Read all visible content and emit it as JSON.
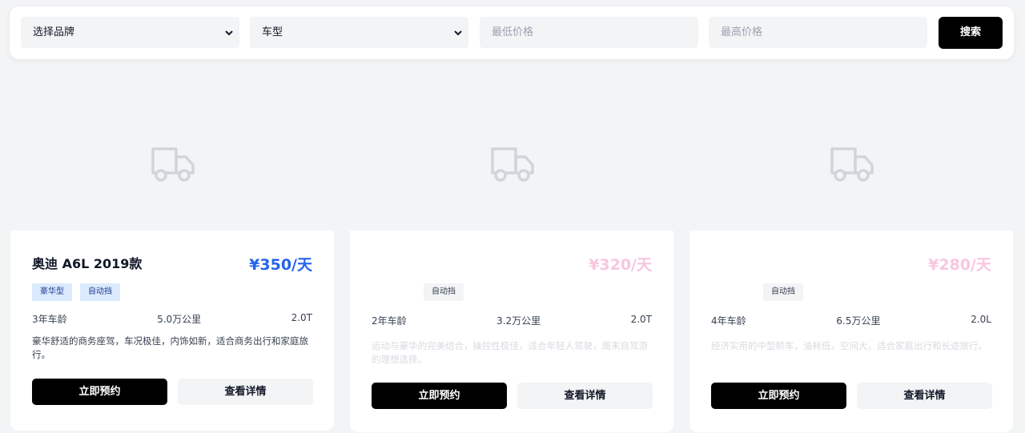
{
  "search": {
    "brand_select": "选择品牌",
    "model_select": "车型",
    "min_price_placeholder": "最低价格",
    "max_price_placeholder": "最高价格",
    "search_label": "搜索"
  },
  "cars": [
    {
      "title": "奥迪 A6L 2019款",
      "price": "¥350/天",
      "tags": [
        "豪华型",
        "自动挡"
      ],
      "age": "3年车龄",
      "mileage": "5.0万公里",
      "engine": "2.0T",
      "description": "豪华舒适的商务座驾，车况极佳，内饰如新，适合商务出行和家庭旅行。",
      "book_label": "立即预约",
      "detail_label": "查看详情"
    },
    {
      "title": "",
      "price": "¥320/天",
      "tags": [
        "自动挡"
      ],
      "age": "2年车龄",
      "mileage": "3.2万公里",
      "engine": "2.0T",
      "description": "运动与豪华的完美结合，操控性极佳，适合年轻人驾驶，周末自驾游的理想选择。",
      "book_label": "立即预约",
      "detail_label": "查看详情"
    },
    {
      "title": "",
      "price": "¥280/天",
      "tags": [
        "自动挡"
      ],
      "age": "4年车龄",
      "mileage": "6.5万公里",
      "engine": "2.0L",
      "description": "经济实用的中型轿车，油耗低，空间大，适合家庭出行和长途旅行。",
      "book_label": "立即预约",
      "detail_label": "查看详情"
    }
  ],
  "colors": {
    "accent_price": "#2563eb",
    "faded_price": "#f9c6dd",
    "primary_button": "#000000"
  }
}
